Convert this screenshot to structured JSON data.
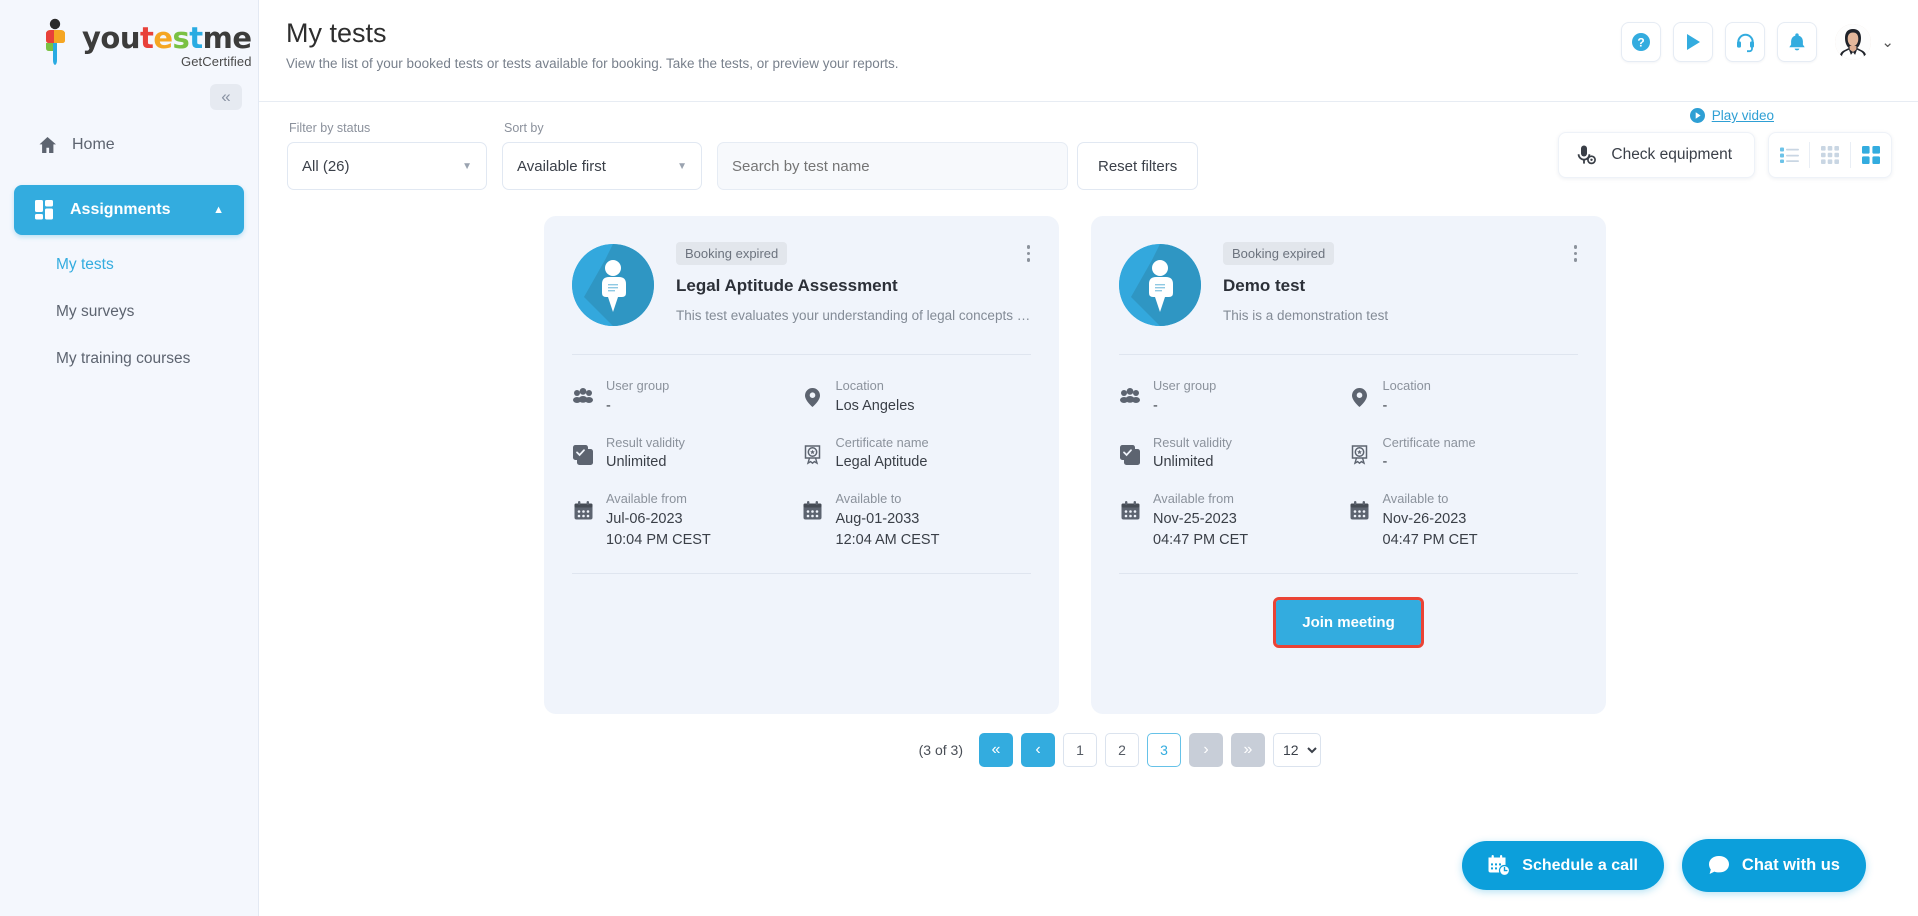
{
  "brand": {
    "logo_parts": [
      {
        "text": "you",
        "color": "#3c3c3b"
      },
      {
        "text": "t",
        "color": "#e8413a"
      },
      {
        "text": "e",
        "color": "#f5a623"
      },
      {
        "text": "s",
        "color": "#7ac143"
      },
      {
        "text": "t",
        "color": "#29abe2"
      },
      {
        "text": "me",
        "color": "#3c3c3b"
      }
    ],
    "logo_full": "youtestme",
    "tagline": "GetCertified"
  },
  "sidebar": {
    "collapse_label": "«",
    "items": [
      {
        "label": "Home",
        "icon": "home-icon",
        "active": false
      },
      {
        "label": "Assignments",
        "icon": "assignments-icon",
        "active": true,
        "caret": "▲"
      }
    ],
    "sub_items": [
      {
        "label": "My tests",
        "selected": true
      },
      {
        "label": "My surveys",
        "selected": false
      },
      {
        "label": "My training courses",
        "selected": false
      }
    ]
  },
  "header": {
    "title": "My tests",
    "subtitle": "View the list of your booked tests or tests available for booking. Take the tests, or preview your reports.",
    "icons": [
      "help-icon",
      "play-icon",
      "support-headset-icon",
      "notification-bell-icon"
    ],
    "avatar_caret": "⌄"
  },
  "filters": {
    "status_label": "Filter by status",
    "status_value": "All (26)",
    "sort_label": "Sort by",
    "sort_value": "Available first",
    "search_placeholder": "Search by test name",
    "search_value": "",
    "reset_label": "Reset filters"
  },
  "tools": {
    "play_video_label": "Play video",
    "check_equipment_label": "Check equipment",
    "views": [
      {
        "name": "list-view-icon",
        "active": false
      },
      {
        "name": "grid-view-icon",
        "active": false
      },
      {
        "name": "card-view-icon",
        "active": true
      }
    ]
  },
  "cards": [
    {
      "status": "Booking expired",
      "title": "Legal Aptitude Assessment",
      "description": "This test evaluates your understanding of legal concepts and …",
      "fields": [
        {
          "icon": "user-group-icon",
          "key": "User group",
          "value": "-"
        },
        {
          "icon": "location-pin-icon",
          "key": "Location",
          "value": "Los Angeles"
        },
        {
          "icon": "result-validity-icon",
          "key": "Result validity",
          "value": "Unlimited"
        },
        {
          "icon": "certificate-icon",
          "key": "Certificate name",
          "value": "Legal Aptitude"
        },
        {
          "icon": "calendar-icon",
          "key": "Available from",
          "value": "Jul-06-2023",
          "value2": "10:04 PM CEST"
        },
        {
          "icon": "calendar-icon",
          "key": "Available to",
          "value": "Aug-01-2033",
          "value2": "12:04 AM CEST"
        }
      ],
      "action": null
    },
    {
      "status": "Booking expired",
      "title": "Demo test",
      "description": "This is a demonstration test",
      "fields": [
        {
          "icon": "user-group-icon",
          "key": "User group",
          "value": "-"
        },
        {
          "icon": "location-pin-icon",
          "key": "Location",
          "value": "-"
        },
        {
          "icon": "result-validity-icon",
          "key": "Result validity",
          "value": "Unlimited"
        },
        {
          "icon": "certificate-icon",
          "key": "Certificate name",
          "value": "-"
        },
        {
          "icon": "calendar-icon",
          "key": "Available from",
          "value": "Nov-25-2023",
          "value2": "04:47 PM CET"
        },
        {
          "icon": "calendar-icon",
          "key": "Available to",
          "value": "Nov-26-2023",
          "value2": "04:47 PM CET"
        }
      ],
      "action": "Join meeting"
    }
  ],
  "pagination": {
    "count_label": "(3 of 3)",
    "first": "«",
    "prev": "‹",
    "pages": [
      "1",
      "2",
      "3"
    ],
    "current_page": "3",
    "next": "›",
    "last": "»",
    "page_size": "12"
  },
  "floating": {
    "schedule_label": "Schedule a call",
    "chat_label": "Chat with us"
  },
  "colors": {
    "accent": "#33acdf",
    "highlight": "#ea4335",
    "card_bg": "#f0f4fb",
    "sidebar_bg": "#f4f7fd"
  }
}
